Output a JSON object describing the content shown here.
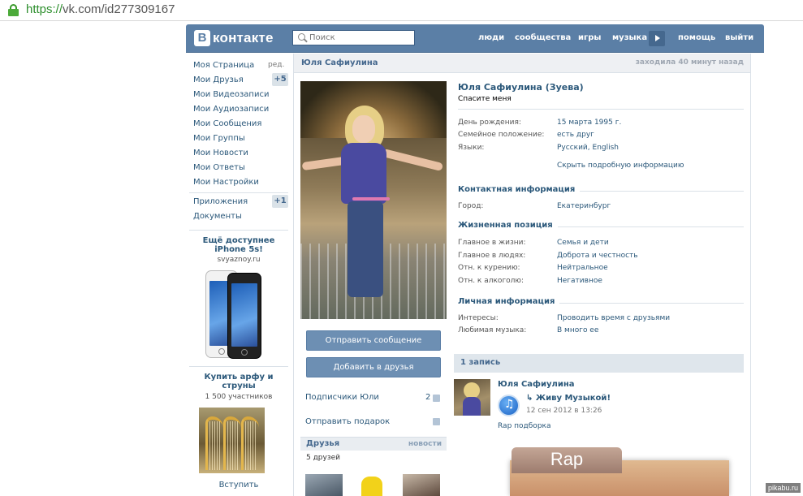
{
  "browser": {
    "url_scheme": "https://",
    "url_rest": "vk.com/id277309167"
  },
  "header": {
    "logo_letter": "B",
    "logo_text": "контакте",
    "search_placeholder": "Поиск",
    "nav": [
      "люди",
      "сообщества",
      "игры",
      "музыка",
      "помощь",
      "выйти"
    ]
  },
  "left_menu": {
    "items": [
      {
        "label": "Моя Страница"
      },
      {
        "label": "Мои Друзья",
        "badge": "+5"
      },
      {
        "label": "Мои Видеозаписи"
      },
      {
        "label": "Мои Аудиозаписи"
      },
      {
        "label": "Мои Сообщения"
      },
      {
        "label": "Мои Группы"
      },
      {
        "label": "Мои Новости"
      },
      {
        "label": "Мои Ответы"
      },
      {
        "label": "Мои Настройки"
      }
    ],
    "edit": "ред.",
    "apps": {
      "label": "Приложения",
      "badge": "+1"
    },
    "docs": "Документы"
  },
  "ads": [
    {
      "title": "Ещё доступнее iPhone 5s!",
      "sub": "svyaznoy.ru"
    },
    {
      "title": "Купить арфу и струны",
      "sub": "1 500 участников",
      "action": "Вступить"
    }
  ],
  "profile": {
    "top_name": "Юля Сафиулина",
    "last_seen": "заходила 40 минут назад",
    "full_name": "Юля Сафиулина (Зуева)",
    "status": "Спасите меня",
    "basic": [
      {
        "label": "День рождения:",
        "value": "15 марта 1995 г."
      },
      {
        "label": "Семейное положение:",
        "value": "есть друг"
      },
      {
        "label": "Языки:",
        "value": "Русский, English"
      }
    ],
    "hide_link": "Скрыть подробную информацию",
    "contact_title": "Контактная информация",
    "contact": [
      {
        "label": "Город:",
        "value": "Екатеринбург"
      }
    ],
    "life_title": "Жизненная позиция",
    "life": [
      {
        "label": "Главное в жизни:",
        "value": "Семья и дети"
      },
      {
        "label": "Главное в людях:",
        "value": "Доброта и честность"
      },
      {
        "label": "Отн. к курению:",
        "value": "Нейтральное"
      },
      {
        "label": "Отн. к алкоголю:",
        "value": "Негативное"
      }
    ],
    "personal_title": "Личная информация",
    "personal": [
      {
        "label": "Интересы:",
        "value": "Проводить время с друзьями"
      },
      {
        "label": "Любимая музыка:",
        "value": "В много ее"
      }
    ]
  },
  "sidebar": {
    "send_message": "Отправить сообщение",
    "add_friend": "Добавить в друзья",
    "followers": "Подписчики Юли",
    "followers_count": "2",
    "send_gift": "Отправить подарок",
    "friends_title": "Друзья",
    "friends_news": "новости",
    "friends_count": "5 друзей"
  },
  "wall": {
    "count": "1 запись",
    "author": "Юля Сафиулина",
    "repost_title": "Живу Музыкой!",
    "date": "12 сен 2012 в 13:26",
    "text": "Rap подборка",
    "image_text": "Rap"
  },
  "watermark": "pikabu.ru",
  "colors": {
    "header_bg": "#5b7fa6",
    "link": "#2b587a",
    "button": "#6d8fb3"
  }
}
